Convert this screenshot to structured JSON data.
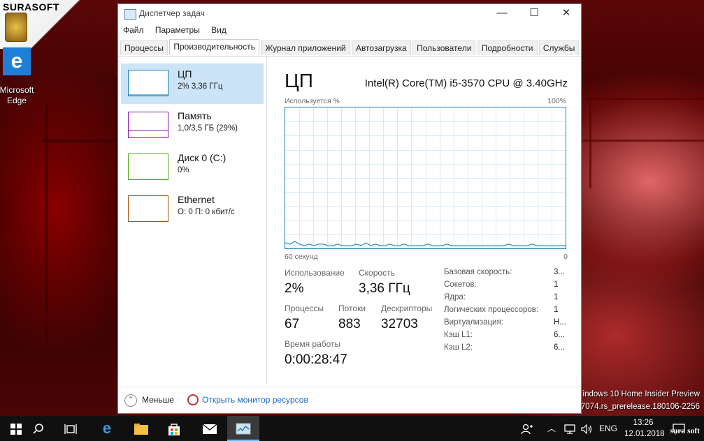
{
  "desktop": {
    "brand": "SURASOFT",
    "edge_label_1": "Microsoft",
    "edge_label_2": "Edge",
    "watermark_line1": "indows 10 Home Insider Preview",
    "watermark_line2": "17074.rs_prerelease.180106-2256",
    "watermark_brand": "sura soft"
  },
  "window": {
    "title": "Диспетчер задач",
    "minimize": "—",
    "maximize": "☐",
    "close": "✕",
    "menu": [
      "Файл",
      "Параметры",
      "Вид"
    ],
    "tabs": [
      "Процессы",
      "Производительность",
      "Журнал приложений",
      "Автозагрузка",
      "Пользователи",
      "Подробности",
      "Службы"
    ],
    "active_tab": "Производительность"
  },
  "resources": [
    {
      "name": "ЦП",
      "value": "2% 3,36 ГГц",
      "color": "#117dbb",
      "selected": true
    },
    {
      "name": "Память",
      "value": "1,0/3,5 ГБ (29%)",
      "color": "#8b12ae",
      "selected": false
    },
    {
      "name": "Диск 0 (C:)",
      "value": "0%",
      "color": "#4da60c",
      "selected": false
    },
    {
      "name": "Ethernet",
      "value": "О: 0 П: 0 кбит/с",
      "color": "#a74f01",
      "selected": false
    }
  ],
  "cpu": {
    "title": "ЦП",
    "model": "Intel(R) Core(TM) i5-3570 CPU @ 3.40GHz",
    "graph_label": "Используется %",
    "graph_max": "100%",
    "graph_min": "0",
    "graph_time": "60 секунд",
    "usage_label": "Использование",
    "usage": "2%",
    "speed_label": "Скорость",
    "speed": "3,36 ГГц",
    "processes_label": "Процессы",
    "processes": "67",
    "threads_label": "Потоки",
    "threads": "883",
    "handles_label": "Дескрипторы",
    "handles": "32703",
    "uptime_label": "Время работы",
    "uptime": "0:00:28:47",
    "details": [
      {
        "k": "Базовая скорость:",
        "v": "3..."
      },
      {
        "k": "Сокетов:",
        "v": "1"
      },
      {
        "k": "Ядра:",
        "v": "1"
      },
      {
        "k": "Логических процессоров:",
        "v": "1"
      },
      {
        "k": "Виртуализация:",
        "v": "Н..."
      },
      {
        "k": "Кэш L1:",
        "v": "6..."
      },
      {
        "k": "Кэш L2:",
        "v": "6..."
      }
    ],
    "history": [
      4,
      3,
      5,
      3,
      2,
      3,
      2,
      3,
      3,
      2,
      2,
      3,
      2,
      2,
      2,
      3,
      2,
      4,
      2,
      3,
      2,
      2,
      3,
      2,
      2,
      3,
      2,
      2,
      2,
      2,
      3,
      2,
      2,
      2,
      3,
      2,
      2,
      2,
      2,
      2,
      2,
      2,
      2,
      2,
      2,
      2,
      2,
      3,
      2,
      2,
      2,
      2,
      3,
      2,
      2,
      2,
      2,
      2,
      2,
      2
    ]
  },
  "footer": {
    "fewer": "Меньше",
    "monitor_link": "Открыть монитор ресурсов"
  },
  "taskbar": {
    "lang": "ENG",
    "time": "13:26",
    "date": "12.01.2018"
  }
}
